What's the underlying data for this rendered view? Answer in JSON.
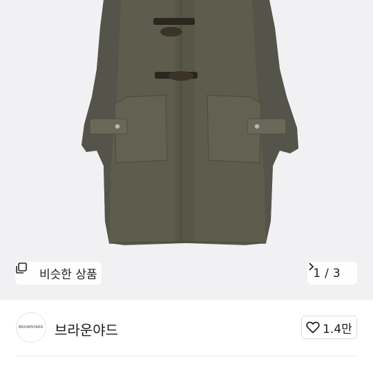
{
  "product": {
    "image_alt": "olive duffle coat",
    "similar_label": "비슷한 상품",
    "similar_icon": "copy-icon",
    "pager": {
      "current": "1",
      "separator": "/",
      "total": "3"
    }
  },
  "seller": {
    "avatar_text": "BROWNYARD",
    "name": "브라운야드",
    "likes": "1.4만",
    "like_icon": "heart-outline-icon"
  },
  "colors": {
    "coat": "#5d5c4d",
    "background": "#f1f1f3"
  }
}
